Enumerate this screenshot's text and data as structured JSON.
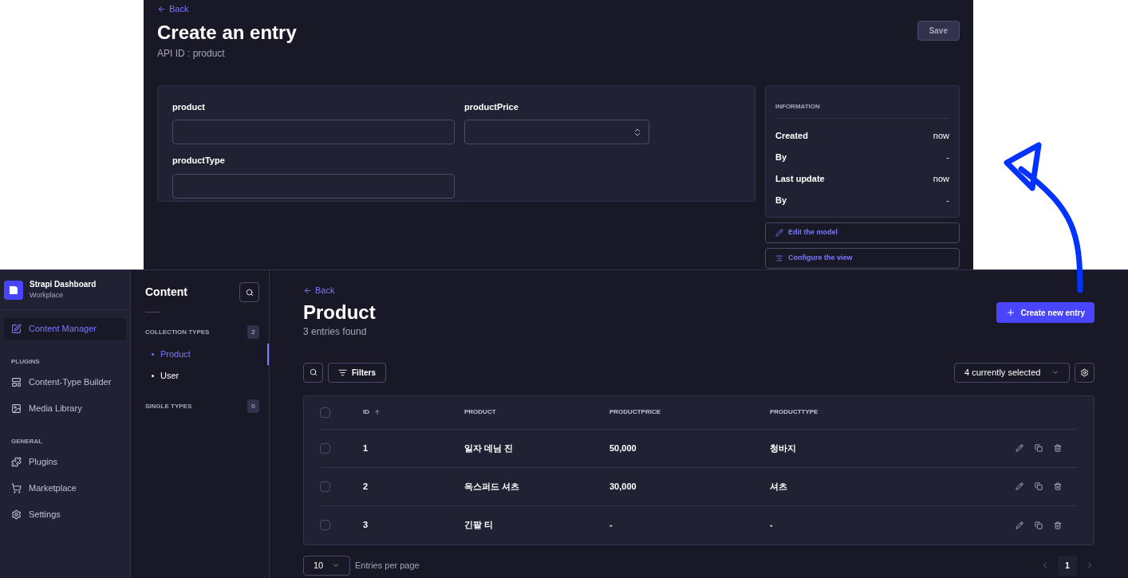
{
  "editor": {
    "back": "Back",
    "title": "Create an entry",
    "subtitle": "API ID : product",
    "save": "Save",
    "fields": [
      {
        "label": "product",
        "kind": "text"
      },
      {
        "label": "productPrice",
        "kind": "number"
      },
      {
        "label": "productType",
        "kind": "text"
      }
    ],
    "information": {
      "heading": "INFORMATION",
      "rows": [
        {
          "label": "Created",
          "value": "now"
        },
        {
          "label": "By",
          "value": "-"
        },
        {
          "label": "Last update",
          "value": "now"
        },
        {
          "label": "By",
          "value": "-"
        }
      ]
    },
    "actions": [
      {
        "label": "Edit the model",
        "kind": "pencil"
      },
      {
        "label": "Configure the view",
        "kind": "list"
      }
    ]
  },
  "sidebar": {
    "brand": "Strapi Dashboard",
    "workspace": "Workplace",
    "sections": [
      {
        "items": [
          {
            "label": "Content Manager",
            "kind": "content",
            "selected": true
          }
        ]
      },
      {
        "heading": "PLUGINS",
        "items": [
          {
            "label": "Content-Type Builder",
            "kind": "layout",
            "selected": false
          },
          {
            "label": "Media Library",
            "kind": "image",
            "selected": false
          }
        ]
      },
      {
        "heading": "GENERAL",
        "items": [
          {
            "label": "Plugins",
            "kind": "puzzle",
            "selected": false
          },
          {
            "label": "Marketplace",
            "kind": "cart",
            "selected": false
          },
          {
            "label": "Settings",
            "kind": "gear",
            "selected": false
          }
        ]
      }
    ]
  },
  "content_nav": {
    "title": "Content",
    "groups": [
      {
        "heading": "COLLECTION TYPES",
        "count": "2",
        "items": [
          {
            "label": "Product",
            "selected": true
          },
          {
            "label": "User",
            "selected": false
          }
        ]
      },
      {
        "heading": "SINGLE TYPES",
        "count": "0"
      }
    ]
  },
  "list": {
    "back": "Back",
    "title": "Product",
    "subtitle": "3 entries found",
    "create": "Create new entry",
    "filters": "Filters",
    "columns_select": "4 currently selected",
    "select_all_checked": false,
    "columns": [
      "ID",
      "PRODUCT",
      "PRODUCTPRICE",
      "PRODUCTTYPE"
    ],
    "rows": [
      {
        "checked": false,
        "cells": [
          "1",
          "일자 데님 진",
          "50,000",
          "청바지"
        ]
      },
      {
        "checked": false,
        "cells": [
          "2",
          "옥스퍼드 셔츠",
          "30,000",
          "셔츠"
        ]
      },
      {
        "checked": false,
        "cells": [
          "3",
          "긴팔 티",
          "-",
          "-"
        ]
      }
    ],
    "page_size": "10",
    "page_size_label": "Entries per page",
    "pages": [
      {
        "label": "1",
        "selected": true
      }
    ]
  }
}
